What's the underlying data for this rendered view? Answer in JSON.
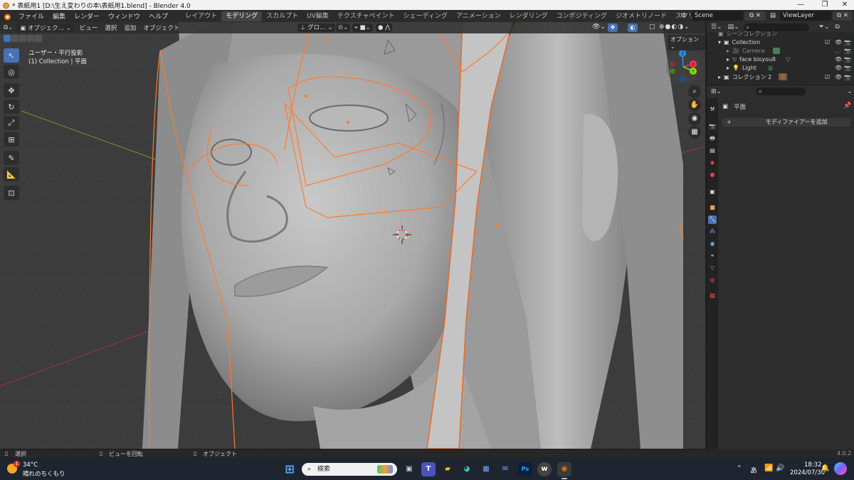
{
  "window": {
    "title": "* 表紙用1 [D:\\生え変わりの本\\表紙用1.blend] - Blender 4.0",
    "controls": [
      "—",
      "❐",
      "✕"
    ]
  },
  "menu": {
    "items": [
      "ファイル",
      "編集",
      "レンダー",
      "ウィンドウ",
      "ヘルプ"
    ]
  },
  "workspaces": {
    "tabs": [
      "レイアウト",
      "モデリング",
      "スカルプト",
      "UV編集",
      "テクスチャペイント",
      "シェーディング",
      "アニメーション",
      "レンダリング",
      "コンポジティング",
      "ジオメトリノード",
      "スクリプト作成"
    ],
    "active": "モデリング",
    "add": "+"
  },
  "scene": {
    "name": "Scene",
    "view_layer": "ViewLayer"
  },
  "viewport_header": {
    "mode": "オブジェク…",
    "menus": [
      "ビュー",
      "選択",
      "追加",
      "オブジェクト"
    ],
    "transform": "グロ…"
  },
  "viewport": {
    "overlay_line1": "ユーザー・平行投影",
    "overlay_line2": "(1) Collection | 平面",
    "options": "オプション ⌄",
    "gizmo": {
      "x": "X",
      "y": "Y",
      "z": "Z"
    }
  },
  "outliner": {
    "rows": [
      {
        "label": "シーンコレクション",
        "indent": 0
      },
      {
        "label": "Collection",
        "indent": 1
      },
      {
        "label": "Camera",
        "indent": 2
      },
      {
        "label": "face bisyou8",
        "indent": 2
      },
      {
        "label": "Light",
        "indent": 2
      },
      {
        "label": "コレクション 2",
        "indent": 1
      }
    ]
  },
  "properties": {
    "object_name": "平面",
    "add_modifier": "モディファイアーを追加"
  },
  "statusbar": {
    "left": "選択",
    "middle": "ビューを回転",
    "right": "オブジェクト",
    "version": "4.0.2"
  },
  "taskbar": {
    "weather_temp": "34°C",
    "weather_desc": "晴れのちくもり",
    "weather_badge": "1",
    "search_placeholder": "検索",
    "ime": "あ",
    "time": "18:32",
    "date": "2024/07/30"
  },
  "colors": {
    "accent": "#4772b3",
    "selection_outline": "#ff7a2e",
    "viewport_bg": "#3d3d3d",
    "axis_x": "#ff3352",
    "axis_y": "#8bdc00",
    "axis_z": "#2890ff"
  }
}
